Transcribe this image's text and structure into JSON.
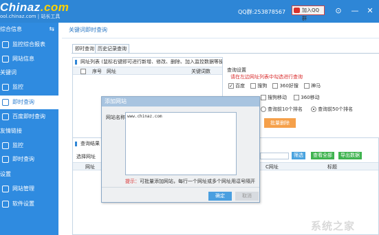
{
  "app": {
    "logo_main": "Chinaz",
    "logo_dot": ".com",
    "logo_sub": "ool.chinaz.com | 站长工具",
    "qq": "QQ群:253878567",
    "add_qq_group": "加入QQ群",
    "window_controls": [
      "⊙",
      "—",
      "✕"
    ]
  },
  "sidebar": {
    "collapse_icon": "⇆",
    "items": [
      {
        "label": "综合信息",
        "type": "group"
      },
      {
        "label": "监控综合报表",
        "type": "child",
        "icon": "chart-icon"
      },
      {
        "label": "网站信息",
        "type": "child",
        "icon": "site-icon"
      },
      {
        "label": "关键词",
        "type": "group"
      },
      {
        "label": "监控",
        "type": "child",
        "icon": "monitor-icon"
      },
      {
        "label": "即时查询",
        "type": "child",
        "icon": "clock-icon",
        "active": true
      },
      {
        "label": "百度即时查询",
        "type": "child",
        "icon": "baidu-icon"
      },
      {
        "label": "友情链接",
        "type": "group"
      },
      {
        "label": "监控",
        "type": "child",
        "icon": "monitor-icon"
      },
      {
        "label": "即时查询",
        "type": "child",
        "icon": "clock-icon"
      },
      {
        "label": "设置",
        "type": "group"
      },
      {
        "label": "网站管理",
        "type": "child",
        "icon": "people-icon"
      },
      {
        "label": "软件设置",
        "type": "child",
        "icon": "gear-icon"
      }
    ]
  },
  "main": {
    "title": "关键词即时查询",
    "tabs": [
      "即时查询",
      "历史记录查询"
    ],
    "url_panel": {
      "heading": "网址列表 (鼠标右键即可进行新增、修改、删除、加入监控数据等操作，双击网址进行关键词管理)",
      "columns": [
        "序号",
        "网址",
        "关键词数"
      ]
    },
    "settings": {
      "heading": "查询设置",
      "notice": "请在左边网址列表中勾选进行查询",
      "engines_row1": [
        {
          "label": "百度",
          "checked": true
        },
        {
          "label": "搜狗",
          "checked": false
        },
        {
          "label": "360好搜",
          "checked": false
        },
        {
          "label": "神马",
          "checked": false
        }
      ],
      "engines_row2": [
        {
          "label": "搜狗移动",
          "checked": false
        },
        {
          "label": "360移动",
          "checked": false
        }
      ],
      "range_options": [
        {
          "label": "查询前10个排名",
          "selected": false
        },
        {
          "label": "查询前50个排名",
          "selected": true
        }
      ],
      "batch_button": "批量删除"
    },
    "results": {
      "heading": "查询结果",
      "select_label": "选择网址",
      "buttons": {
        "filter": "筛选",
        "view_all": "查看全部",
        "export": "导出数据"
      },
      "columns": [
        "网址",
        "C网址",
        "标题"
      ]
    }
  },
  "modal": {
    "title": "添加网站",
    "field_label": "网站名称",
    "text_value": "www.chinaz.com",
    "tip_key": "提示：",
    "tip_text": "可批量添加网站，每行一个网址或多个网址用逗号隔开",
    "confirm": "确定",
    "cancel": "取消"
  },
  "watermark": "系统之家",
  "colors": {
    "brand": "#2f8be0",
    "warning": "#d92b2b",
    "green_button": "#3fb34f",
    "orange_button": "#f5a04a"
  }
}
